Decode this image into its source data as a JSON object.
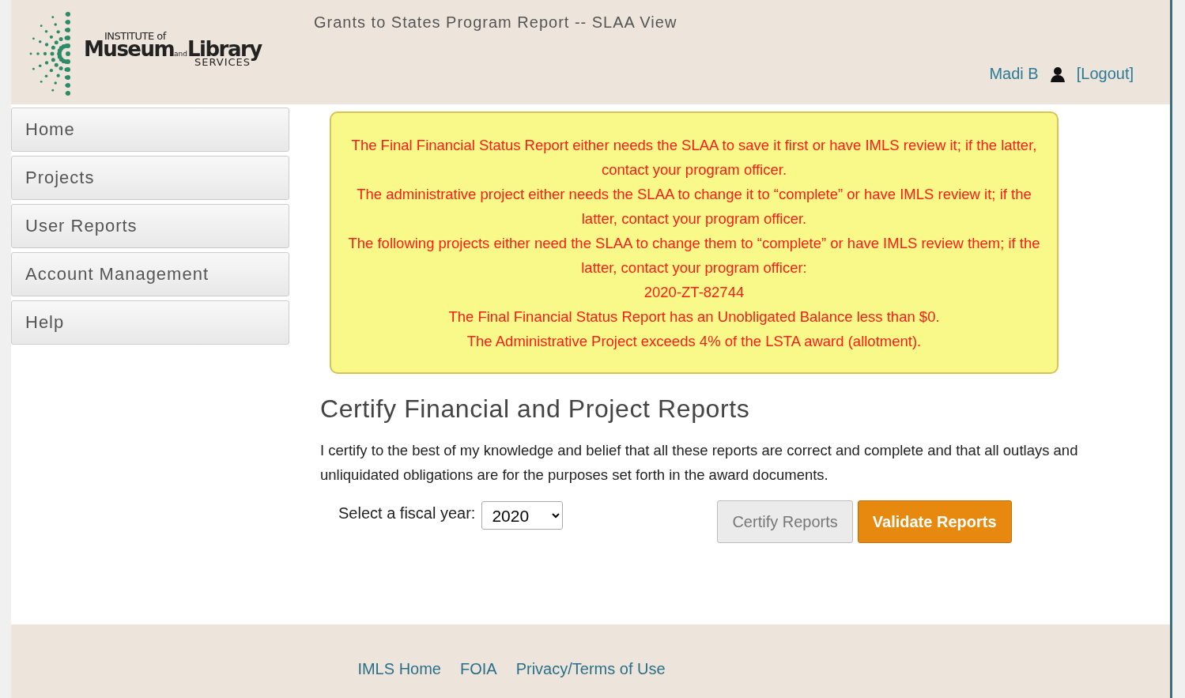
{
  "logo": {
    "line_1": "INSTITUTE of",
    "word_1": "Museum",
    "word_2": "and",
    "word_3": "Library",
    "line_3": "SERVICES"
  },
  "header": {
    "title": "Grants to States Program Report -- SLAA View",
    "user": "Madi B",
    "logout": "[Logout]"
  },
  "sidebar": {
    "items": [
      {
        "label": "Home"
      },
      {
        "label": "Projects"
      },
      {
        "label": "User Reports"
      },
      {
        "label": "Account Management"
      },
      {
        "label": "Help"
      }
    ]
  },
  "alert": {
    "lines": [
      "The Final Financial Status Report either needs the SLAA to save it first or have IMLS review it; if the latter, contact your program officer.",
      "The administrative project either needs the SLAA to change it to “complete” or have IMLS review it; if the latter, contact your program officer.",
      "The following projects either need the SLAA to change them to “complete” or have IMLS review them; if the latter, contact your program officer:",
      "2020-ZT-82744",
      "The Final Financial Status Report has an Unobligated Balance less than $0.",
      "The Administrative Project exceeds 4% of the LSTA award (allotment)."
    ]
  },
  "heading": "Certify Financial and Project Reports",
  "statement": "I certify to the best of my knowledge and belief that all these reports are correct and complete and that all outlays and unliquidated obligations are for the purposes set forth in the award documents.",
  "fiscal_year": {
    "label": "Select a fiscal year:",
    "value": "2020"
  },
  "buttons": [
    {
      "label": "Certify Reports",
      "kind": "secondary",
      "disabled": true
    },
    {
      "label": "Validate Reports",
      "kind": "primary",
      "disabled": false
    }
  ],
  "footer": {
    "links": [
      "IMLS Home",
      "FOIA",
      "Privacy/Terms of Use"
    ]
  }
}
